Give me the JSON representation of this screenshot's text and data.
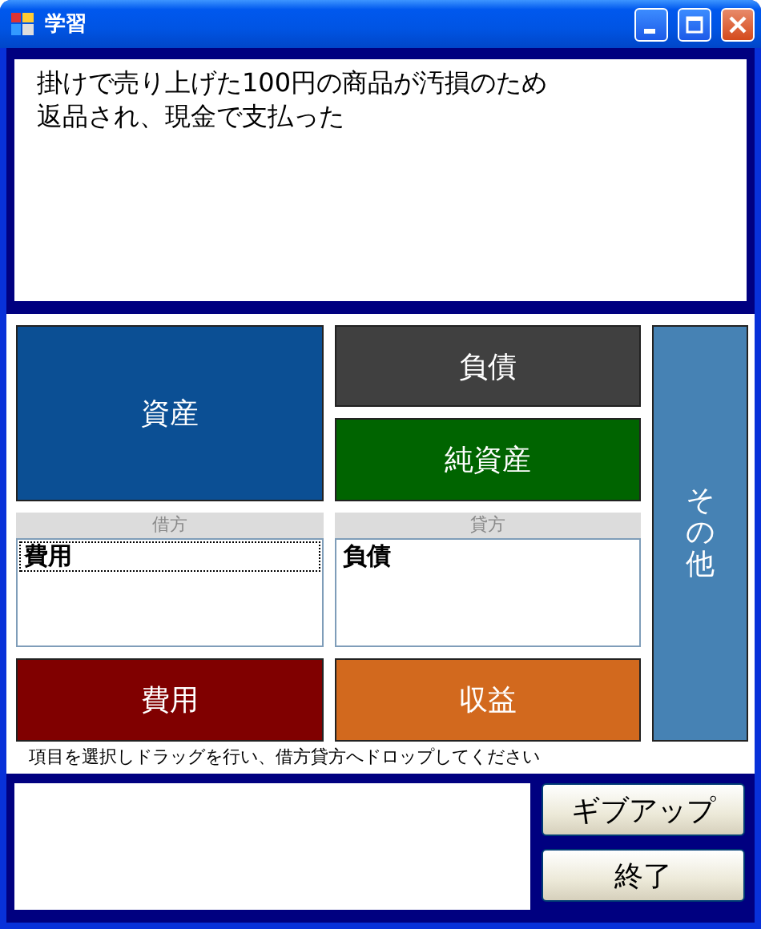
{
  "window": {
    "title": "学習"
  },
  "question_lines": [
    "掛けで売り上げた100円の商品が汚損のため",
    "返品され、現金で支払った"
  ],
  "tiles": [
    {
      "label": "資産",
      "color": "#0b4f94"
    },
    {
      "label": "負債",
      "color": "#404040"
    },
    {
      "label": "純資産",
      "color": "#006400"
    },
    {
      "label": "その他",
      "color": "#4682b4"
    },
    {
      "label": "費用",
      "color": "#800000"
    },
    {
      "label": "収益",
      "color": "#d2691e"
    }
  ],
  "debit": {
    "header": "借方",
    "items": [
      {
        "label": "費用",
        "selected": true
      }
    ]
  },
  "credit": {
    "header": "貸方",
    "items": [
      {
        "label": "負債",
        "selected": false
      }
    ]
  },
  "hint": "項目を選択しドラッグを行い、借方貸方へドロップしてください",
  "buttons": [
    "ギブアップ",
    "終了"
  ]
}
